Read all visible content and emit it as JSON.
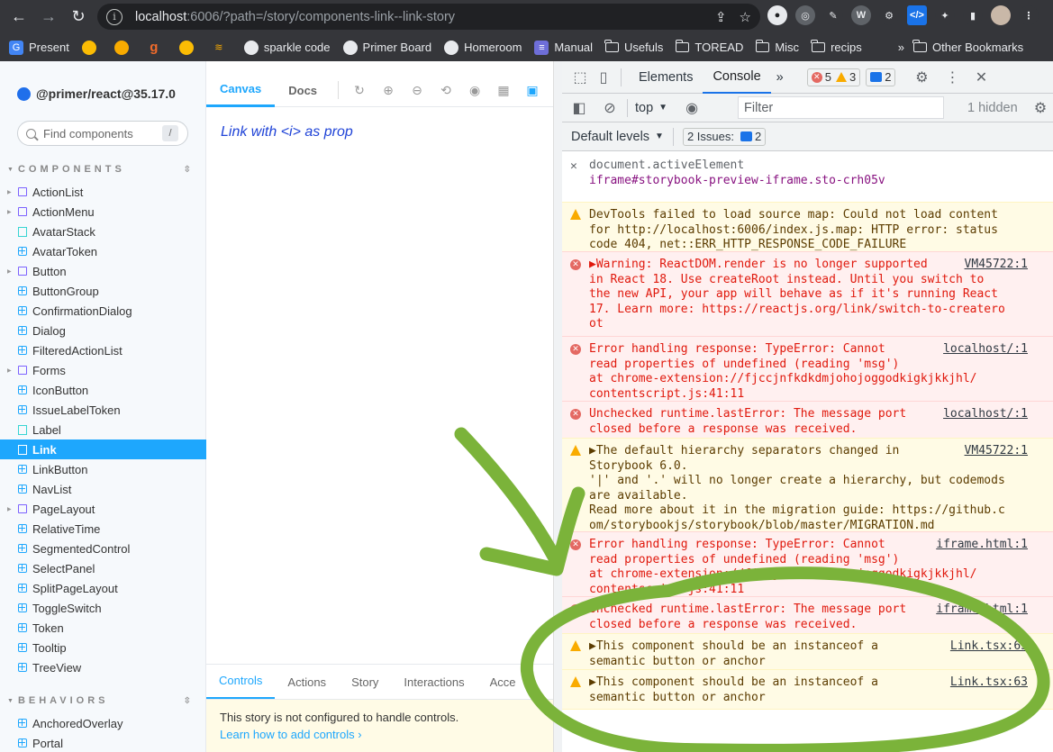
{
  "browser": {
    "url_host": "localhost",
    "url_rest": ":6006/?path=/story/components-link--link-story",
    "bookmarks": [
      "Present",
      "sparkle code",
      "Primer Board",
      "Homeroom",
      "Manual",
      "Usefuls",
      "TOREAD",
      "Misc",
      "recips"
    ],
    "overflow": "»",
    "other_bookmarks": "Other Bookmarks"
  },
  "sidebar": {
    "brand": "@primer/react@35.17.0",
    "search_placeholder": "Find components",
    "search_shortcut": "/",
    "components_title": "COMPONENTS",
    "components": [
      {
        "label": "ActionList",
        "icon": "folder-icon"
      },
      {
        "label": "ActionMenu",
        "icon": "folder-icon"
      },
      {
        "label": "AvatarStack",
        "icon": "story-icon"
      },
      {
        "label": "AvatarToken",
        "icon": "component-icon"
      },
      {
        "label": "Button",
        "icon": "folder-icon"
      },
      {
        "label": "ButtonGroup",
        "icon": "component-icon"
      },
      {
        "label": "ConfirmationDialog",
        "icon": "component-icon"
      },
      {
        "label": "Dialog",
        "icon": "component-icon"
      },
      {
        "label": "FilteredActionList",
        "icon": "component-icon"
      },
      {
        "label": "Forms",
        "icon": "folder-icon"
      },
      {
        "label": "IconButton",
        "icon": "component-icon"
      },
      {
        "label": "IssueLabelToken",
        "icon": "component-icon"
      },
      {
        "label": "Label",
        "icon": "story-icon"
      },
      {
        "label": "Link",
        "icon": "story-icon"
      },
      {
        "label": "LinkButton",
        "icon": "component-icon"
      },
      {
        "label": "NavList",
        "icon": "component-icon"
      },
      {
        "label": "PageLayout",
        "icon": "folder-icon"
      },
      {
        "label": "RelativeTime",
        "icon": "component-icon"
      },
      {
        "label": "SegmentedControl",
        "icon": "component-icon"
      },
      {
        "label": "SelectPanel",
        "icon": "component-icon"
      },
      {
        "label": "SplitPageLayout",
        "icon": "component-icon"
      },
      {
        "label": "ToggleSwitch",
        "icon": "component-icon"
      },
      {
        "label": "Token",
        "icon": "component-icon"
      },
      {
        "label": "Tooltip",
        "icon": "component-icon"
      },
      {
        "label": "TreeView",
        "icon": "component-icon"
      }
    ],
    "selected": "Link",
    "behaviors_title": "BEHAVIORS",
    "behaviors": [
      {
        "label": "AnchoredOverlay",
        "icon": "component-icon"
      },
      {
        "label": "Portal",
        "icon": "component-icon"
      }
    ]
  },
  "main": {
    "tabs": [
      "Canvas",
      "Docs"
    ],
    "active_tab": "Canvas",
    "canvas_text": "Link with <i> as prop",
    "addon_tabs": [
      "Controls",
      "Actions",
      "Story",
      "Interactions",
      "Acce"
    ],
    "notice_text": "This story is not configured to handle controls.",
    "notice_link": "Learn how to add controls ›"
  },
  "devtools": {
    "tabs": [
      "Elements",
      "Console"
    ],
    "active_tab": "Console",
    "overflow": "»",
    "error_count": "5",
    "warning_count": "3",
    "message_count": "2",
    "context": "top",
    "filter_placeholder": "Filter",
    "hidden": "1 hidden",
    "levels": "Default levels",
    "issues_label": "2 Issues:",
    "issues_count": "2",
    "entries": [
      {
        "type": "eval",
        "lines": [
          "document.activeElement",
          "iframe#storybook-preview-iframe.sto-crh05v"
        ],
        "source": ""
      },
      {
        "type": "warn",
        "lines": [
          "DevTools failed to load source map: Could not load content",
          "for http://localhost:6006/index.js.map: HTTP error: status",
          "code 404, net::ERR_HTTP_RESPONSE_CODE_FAILURE"
        ],
        "source": ""
      },
      {
        "type": "err",
        "lines": [
          "▶Warning: ReactDOM.render is no longer supported",
          "in React 18. Use createRoot instead. Until you switch to",
          "the new API, your app will behave as if it's running React",
          "17. Learn more: https://reactjs.org/link/switch-to-createro",
          "ot"
        ],
        "source": "VM45722:1"
      },
      {
        "type": "err",
        "lines": [
          "Error handling response: TypeError: Cannot",
          "read properties of undefined (reading 'msg')",
          "    at chrome-extension://fjccjnfkdkdmjohojoggodkigkjkkjhl/",
          "contentscript.js:41:11"
        ],
        "source": "localhost/:1"
      },
      {
        "type": "err",
        "lines": [
          "Unchecked runtime.lastError: The message port",
          "closed before a response was received."
        ],
        "source": "localhost/:1"
      },
      {
        "type": "warn",
        "lines": [
          "▶The default hierarchy separators changed in",
          "Storybook 6.0.",
          "'|' and '.' will no longer create a hierarchy, but codemods",
          "are available.",
          "Read more about it in the migration guide: https://github.c",
          "om/storybookjs/storybook/blob/master/MIGRATION.md"
        ],
        "source": "VM45722:1"
      },
      {
        "type": "err",
        "lines": [
          "Error handling response: TypeError: Cannot",
          "read properties of undefined (reading 'msg')",
          "    at chrome-extension://fjccjnfkdkdmjohojoggodkigkjkkjhl/",
          "contentscript.js:41:11"
        ],
        "source": "iframe.html:1"
      },
      {
        "type": "err",
        "lines": [
          "Unchecked runtime.lastError: The message port",
          "closed before a response was received."
        ],
        "source": "iframe.html:1"
      },
      {
        "type": "warn",
        "lines": [
          "▶This component should be an instanceof a",
          "semantic button or anchor"
        ],
        "source": "Link.tsx:63"
      },
      {
        "type": "warn",
        "lines": [
          "▶This component should be an instanceof a",
          "semantic button or anchor"
        ],
        "source": "Link.tsx:63"
      }
    ],
    "prompt": "›"
  },
  "annotation": {
    "color": "#7bb33a"
  }
}
